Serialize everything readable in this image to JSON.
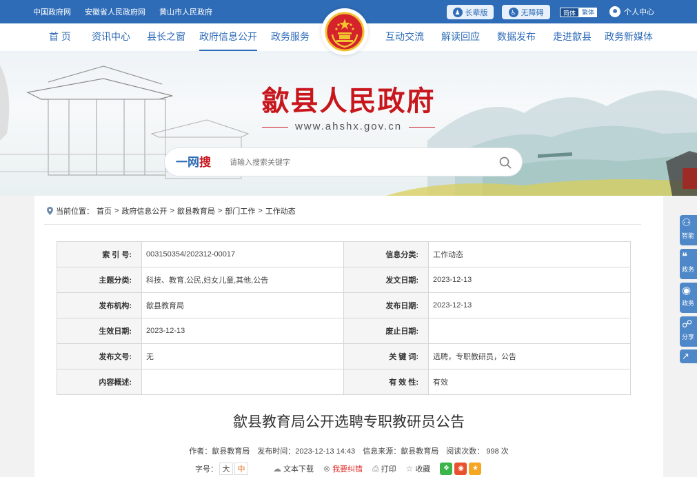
{
  "topbar": {
    "links": [
      "中国政府网",
      "安徽省人民政府网",
      "黄山市人民政府"
    ],
    "elder_label": "长辈版",
    "accessible_label": "无障碍",
    "lang_simplified": "简体",
    "lang_traditional": "繁体",
    "user_label": "个人中心"
  },
  "nav": {
    "items": [
      "首 页",
      "资讯中心",
      "县长之窗",
      "政府信息公开",
      "政务服务",
      "互动交流",
      "解读回应",
      "数据发布",
      "走进歙县",
      "政务新媒体"
    ]
  },
  "banner": {
    "title": "歙县人民政府",
    "url": "www.ahshx.gov.cn",
    "search_logo_a": "一网",
    "search_logo_b": "搜",
    "search_placeholder": "请输入搜索关键字"
  },
  "breadcrumb": {
    "prefix": "当前位置：",
    "items": [
      "首页",
      "政府信息公开",
      "歙县教育局",
      "部门工作",
      "工作动态"
    ],
    "sep": ">"
  },
  "meta": {
    "rows": [
      [
        {
          "k": "索 引 号:",
          "v": "003150354/202312-00017"
        },
        {
          "k": "信息分类:",
          "v": "工作动态"
        }
      ],
      [
        {
          "k": "主题分类:",
          "v": "科技、教育,公民,妇女儿童,其他,公告"
        },
        {
          "k": "发文日期:",
          "v": "2023-12-13"
        }
      ],
      [
        {
          "k": "发布机构:",
          "v": "歙县教育局"
        },
        {
          "k": "发布日期:",
          "v": "2023-12-13"
        }
      ],
      [
        {
          "k": "生效日期:",
          "v": "2023-12-13"
        },
        {
          "k": "废止日期:",
          "v": ""
        }
      ],
      [
        {
          "k": "发布文号:",
          "v": "无"
        },
        {
          "k": "关 键 词:",
          "v": "选聘，专职教研员，公告"
        }
      ],
      [
        {
          "k": "内容概述:",
          "v": ""
        },
        {
          "k": "有 效 性:",
          "v": "有效"
        }
      ]
    ]
  },
  "article": {
    "title": "歙县教育局公开选聘专职教研员公告",
    "author": "作者：歙县教育局",
    "time": "发布时间：2023-12-13 14:43",
    "source": "信息来源：歙县教育局",
    "reads": "阅读次数：  998 次",
    "font_label": "字号：",
    "font_big": "大",
    "font_mid": "中",
    "download": "文本下载",
    "correct": "我要纠错",
    "print": "打印",
    "favorite": "收藏"
  },
  "side": {
    "items": [
      "智能",
      "政务",
      "政务",
      "分享"
    ]
  },
  "colors": {
    "primary": "#2f6cb7",
    "title_red": "#c8161d",
    "wechat": "#3bb44a",
    "weibo": "#e8502e",
    "star": "#f5a623"
  }
}
